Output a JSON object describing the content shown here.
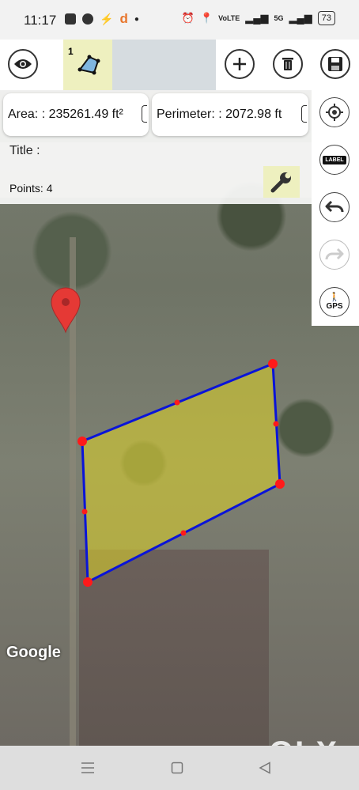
{
  "status_bar": {
    "time": "11:17",
    "notification_d": "d",
    "network_label": "VoLTE",
    "signal_label": "5G",
    "battery": "73"
  },
  "toolbar": {
    "layer_number": "1",
    "icons": [
      "eye-icon",
      "polygon-layer-icon",
      "add-icon",
      "trash-icon",
      "save-icon"
    ]
  },
  "info": {
    "area_text": "Area: : 235261.49 ft²",
    "perimeter_text": "Perimeter: : 2072.98 ft",
    "title_label": "Title :",
    "points_label": "Points: 4"
  },
  "sidebar": {
    "label_chip": "LABEL",
    "gps_label": "GPS",
    "icons": [
      "locate-icon",
      "label-icon",
      "undo-icon",
      "redo-icon",
      "gps-walk-icon"
    ]
  },
  "map": {
    "provider_logo": "Google",
    "polygon_fill": "#c8c23a",
    "polygon_stroke": "#0a14d8",
    "vertex_color": "#ff1a1a",
    "pin_color": "#e53935"
  },
  "watermark": "OLX",
  "colors": {
    "highlight_tab": "#eef0bf",
    "panel_gray": "#d6dce0"
  }
}
